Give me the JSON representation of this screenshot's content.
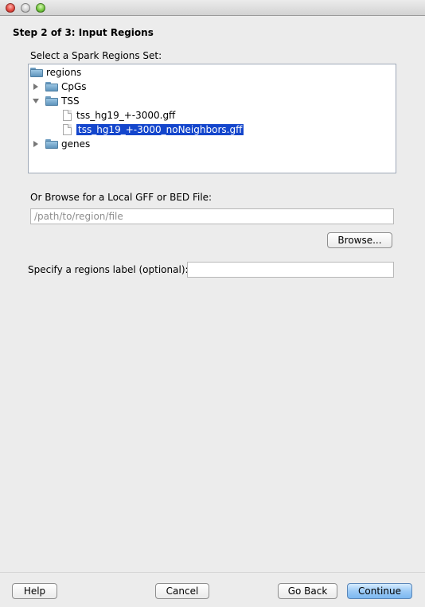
{
  "window": {
    "controls": [
      "close",
      "minimize",
      "maximize"
    ]
  },
  "step_title": "Step 2 of 3: Input Regions",
  "tree_section": {
    "label": "Select a Spark Regions Set:",
    "items": [
      {
        "label": "regions",
        "type": "folder",
        "level": 0,
        "expanded": true
      },
      {
        "label": "CpGs",
        "type": "folder",
        "level": 1,
        "expanded": false
      },
      {
        "label": "TSS",
        "type": "folder",
        "level": 1,
        "expanded": true
      },
      {
        "label": "tss_hg19_+-3000.gff",
        "type": "file",
        "level": 2,
        "selected": false
      },
      {
        "label": "tss_hg19_+-3000_noNeighbors.gff",
        "type": "file",
        "level": 2,
        "selected": true
      },
      {
        "label": "genes",
        "type": "folder",
        "level": 1,
        "expanded": false
      }
    ]
  },
  "browse_section": {
    "label": "Or Browse for a Local GFF or BED File:",
    "path_value": "",
    "path_placeholder": "/path/to/region/file",
    "browse_label": "Browse..."
  },
  "regions_label": {
    "label": "Specify a regions label (optional):",
    "value": ""
  },
  "footer": {
    "help": "Help",
    "cancel": "Cancel",
    "go_back": "Go Back",
    "continue": "Continue"
  }
}
